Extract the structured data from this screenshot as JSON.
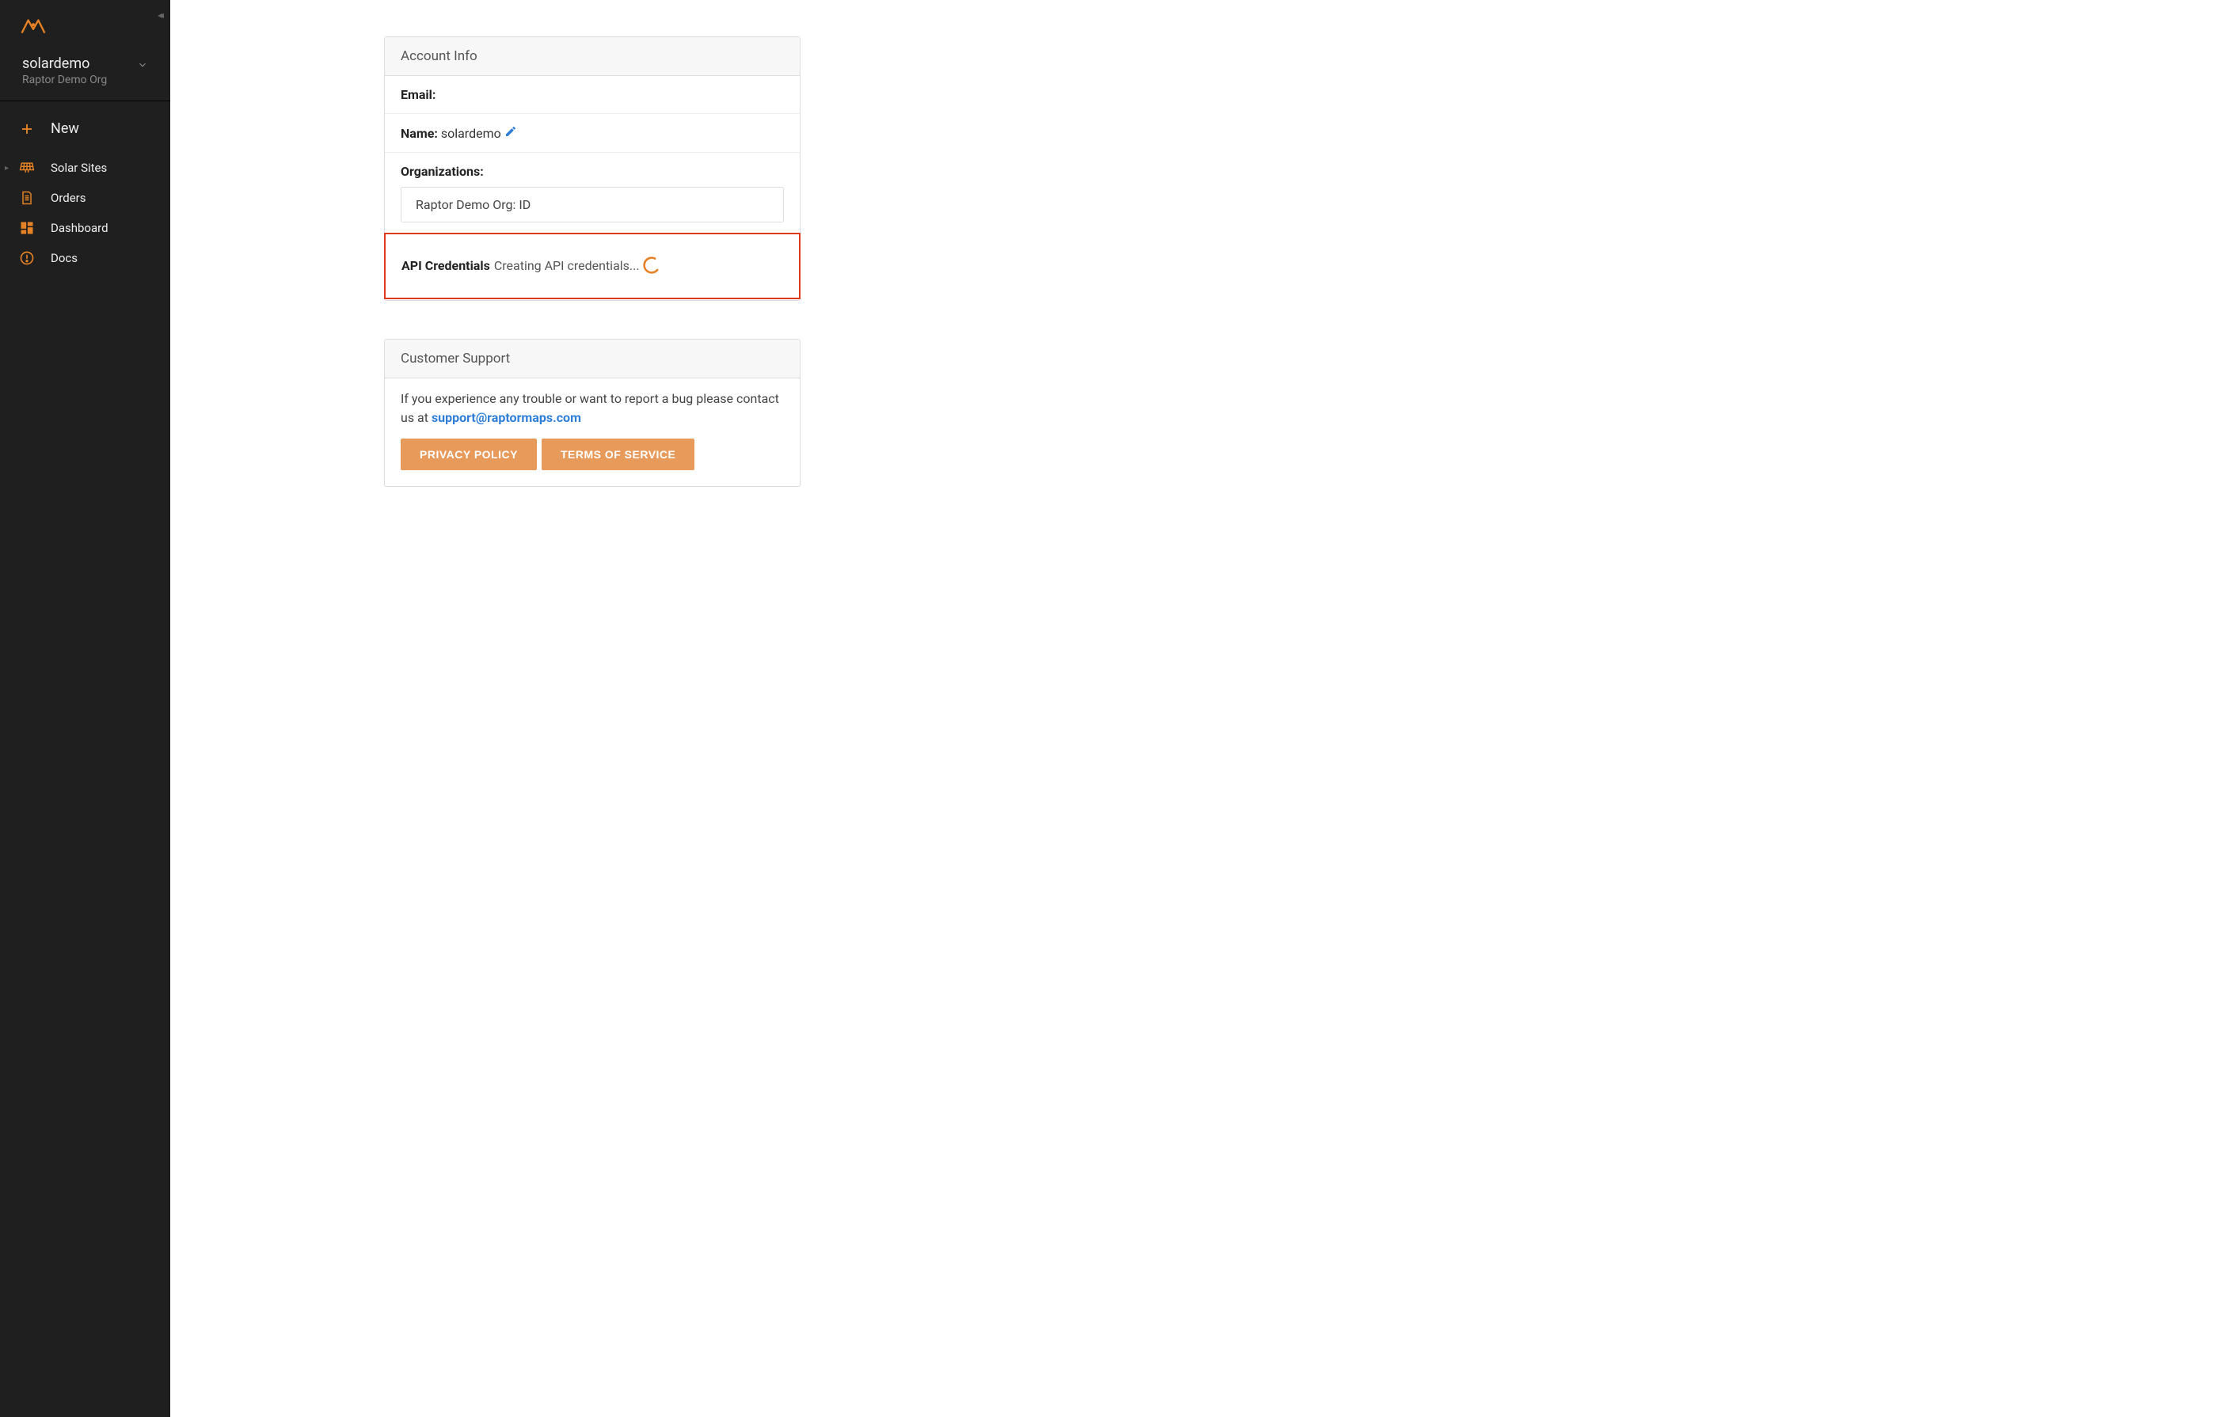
{
  "sidebar": {
    "username": "solardemo",
    "org": "Raptor Demo Org",
    "new_label": "New",
    "items": [
      {
        "label": "Solar Sites"
      },
      {
        "label": "Orders"
      },
      {
        "label": "Dashboard"
      },
      {
        "label": "Docs"
      }
    ]
  },
  "account": {
    "header": "Account Info",
    "email_label": "Email:",
    "name_label": "Name:",
    "name_value": "solardemo",
    "orgs_label": "Organizations:",
    "org_entry": "Raptor Demo Org: ID",
    "api_label": "API Credentials",
    "api_status": "Creating API credentials..."
  },
  "support": {
    "header": "Customer Support",
    "body_prefix": "If you experience any trouble or want to report a bug please contact us at ",
    "email": "support@raptormaps.com",
    "privacy_btn": "PRIVACY POLICY",
    "terms_btn": "TERMS OF SERVICE"
  }
}
